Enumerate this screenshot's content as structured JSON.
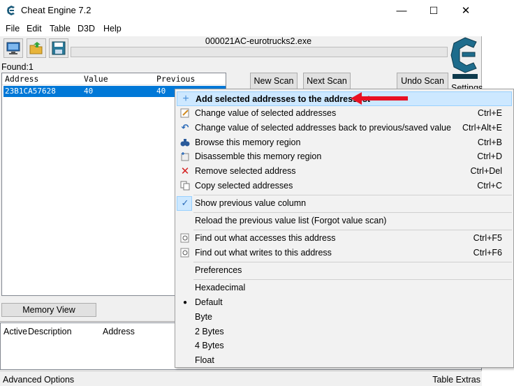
{
  "window": {
    "title": "Cheat Engine 7.2",
    "minimize": "—",
    "maximize": "☐",
    "close": "✕"
  },
  "menu": [
    "File",
    "Edit",
    "Table",
    "D3D",
    "Help"
  ],
  "process": {
    "name": "000021AC-eurotrucks2.exe"
  },
  "found": "Found:1",
  "results": {
    "columns": [
      "Address",
      "Value",
      "Previous"
    ],
    "rows": [
      {
        "address": "23B1CA57628",
        "value": "40",
        "previous": "40"
      }
    ]
  },
  "scan_buttons": {
    "new_scan": "New Scan",
    "next_scan": "Next Scan",
    "undo_scan": "Undo Scan"
  },
  "settings_label": "Settings",
  "memory_view": "Memory View",
  "address_list": {
    "columns": [
      "Active",
      "Description",
      "Address"
    ]
  },
  "status": {
    "left": "Advanced Options",
    "right": "Table Extras"
  },
  "context_menu": {
    "items": [
      {
        "label": "Add selected addresses to the addresslist",
        "shortcut": "",
        "icon": "plus-icon"
      },
      {
        "label": "Change value of selected addresses",
        "shortcut": "Ctrl+E",
        "icon": "edit-icon"
      },
      {
        "label": "Change value of selected addresses back to previous/saved value",
        "shortcut": "Ctrl+Alt+E",
        "icon": "undo-icon"
      },
      {
        "label": "Browse this memory region",
        "shortcut": "Ctrl+B",
        "icon": "binoculars-icon"
      },
      {
        "label": "Disassemble this memory region",
        "shortcut": "Ctrl+D",
        "icon": "disassemble-icon"
      },
      {
        "label": "Remove selected address",
        "shortcut": "Ctrl+Del",
        "icon": "delete-icon"
      },
      {
        "label": "Copy selected addresses",
        "shortcut": "Ctrl+C",
        "icon": "copy-icon"
      },
      {
        "label": "Show previous value column",
        "shortcut": "",
        "icon": "check-icon"
      },
      {
        "label": "Reload the previous value list (Forgot value scan)",
        "shortcut": "",
        "icon": ""
      },
      {
        "label": "Find out what accesses this address",
        "shortcut": "Ctrl+F5",
        "icon": "magnifier-icon"
      },
      {
        "label": "Find out what writes to this address",
        "shortcut": "Ctrl+F6",
        "icon": "magnifier-icon"
      },
      {
        "label": "Preferences",
        "shortcut": "",
        "icon": ""
      },
      {
        "label": "Hexadecimal",
        "shortcut": "",
        "icon": ""
      },
      {
        "label": "Default",
        "shortcut": "",
        "icon": "radio-dot-icon"
      },
      {
        "label": "Byte",
        "shortcut": "",
        "icon": ""
      },
      {
        "label": "2 Bytes",
        "shortcut": "",
        "icon": ""
      },
      {
        "label": "4 Bytes",
        "shortcut": "",
        "icon": ""
      },
      {
        "label": "Float",
        "shortcut": "",
        "icon": ""
      }
    ]
  },
  "colors": {
    "selection": "#0078d7",
    "highlight": "#cde8ff",
    "annotation_arrow": "#e81123"
  }
}
